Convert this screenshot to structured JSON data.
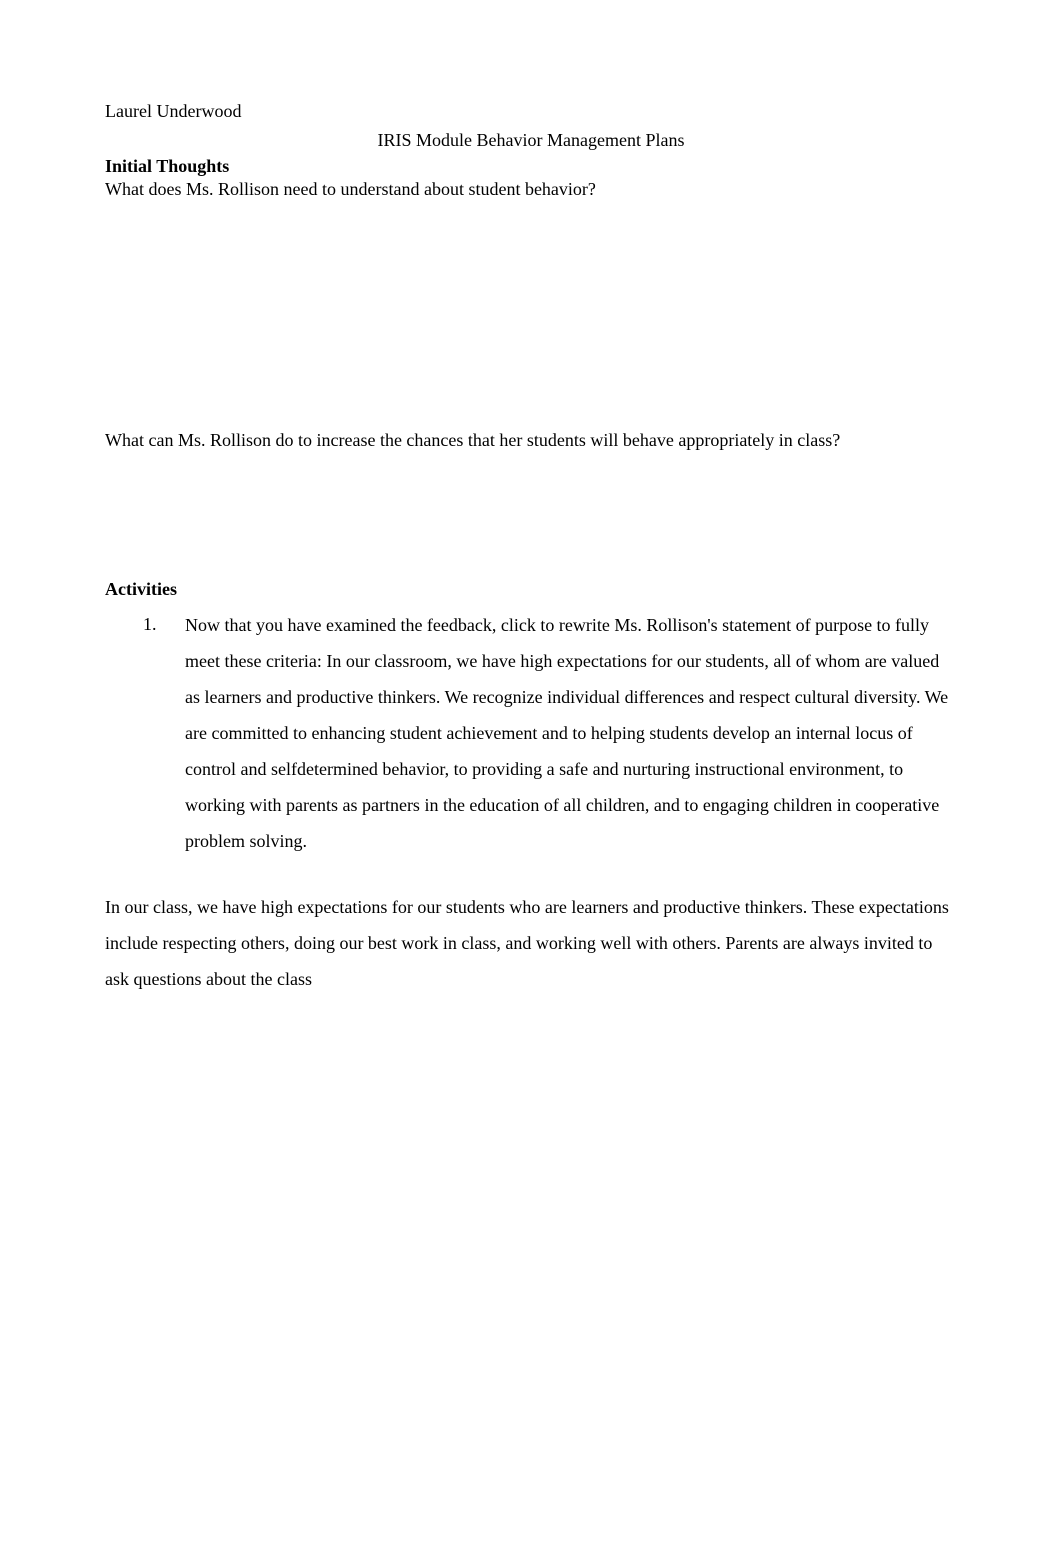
{
  "author": "Laurel Underwood",
  "title": "IRIS Module Behavior Management Plans",
  "sections": {
    "initial_thoughts": {
      "heading": "Initial Thoughts",
      "question1": "What does Ms. Rollison need to understand about student behavior?",
      "question2": "What can Ms. Rollison do to increase the chances that her students will behave appropriately in class?"
    },
    "activities": {
      "heading": "Activities",
      "items": [
        {
          "number": "1.",
          "text": "Now that you have examined the feedback, click to rewrite Ms. Rollison's statement of purpose to fully meet these criteria: In our classroom, we have high expectations for our students, all of whom are valued as learners and productive thinkers. We recognize individual differences and respect cultural diversity. We are committed to enhancing student achievement and to helping students develop an internal locus of control and selfdetermined behavior, to providing a safe and nurturing instructional environment, to working with parents as partners in the education of all children, and to engaging children in cooperative problem solving."
        }
      ]
    },
    "closing_paragraph": "In our class, we have high expectations for our students who are learners and productive thinkers. These expectations include respecting others, doing our best work in class, and working well with others. Parents are always invited to ask questions about the class"
  }
}
